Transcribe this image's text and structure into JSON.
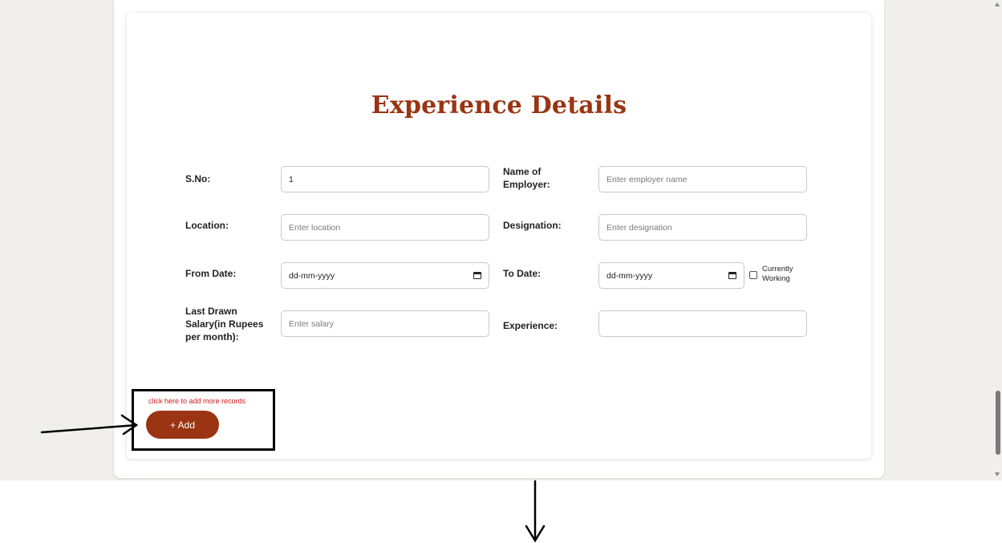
{
  "form": {
    "title": "Experience Details",
    "fields": {
      "sno": {
        "label": "S.No:",
        "value": "1"
      },
      "employer": {
        "label_line1": "Name of",
        "label_line2": "Employer:",
        "placeholder": "Enter employer name"
      },
      "location": {
        "label": "Location:",
        "placeholder": "Enter location"
      },
      "designation": {
        "label": "Designation:",
        "placeholder": "Enter designation"
      },
      "from_date": {
        "label": "From Date:",
        "placeholder": "dd-mm-yyyy"
      },
      "to_date": {
        "label": "To Date:",
        "placeholder": "dd-mm-yyyy"
      },
      "currently_working": {
        "label_line1": "Currently",
        "label_line2": "Working",
        "checked": false
      },
      "salary": {
        "label_line1": "Last Drawn",
        "label_line2": "Salary(in Rupees",
        "label_line3": "per month):",
        "placeholder": "Enter salary"
      },
      "experience": {
        "label": "Experience:",
        "value": ""
      }
    },
    "add_hint": "click here to add more records",
    "add_button": "+ Add"
  },
  "icons": {
    "calendar": "calendar-icon",
    "arrow_right": "arrow-right-annotation",
    "arrow_down": "arrow-down-annotation"
  },
  "colors": {
    "accent": "#9a3412",
    "hint": "#d11a1a",
    "page_bg": "#f1efeb"
  }
}
